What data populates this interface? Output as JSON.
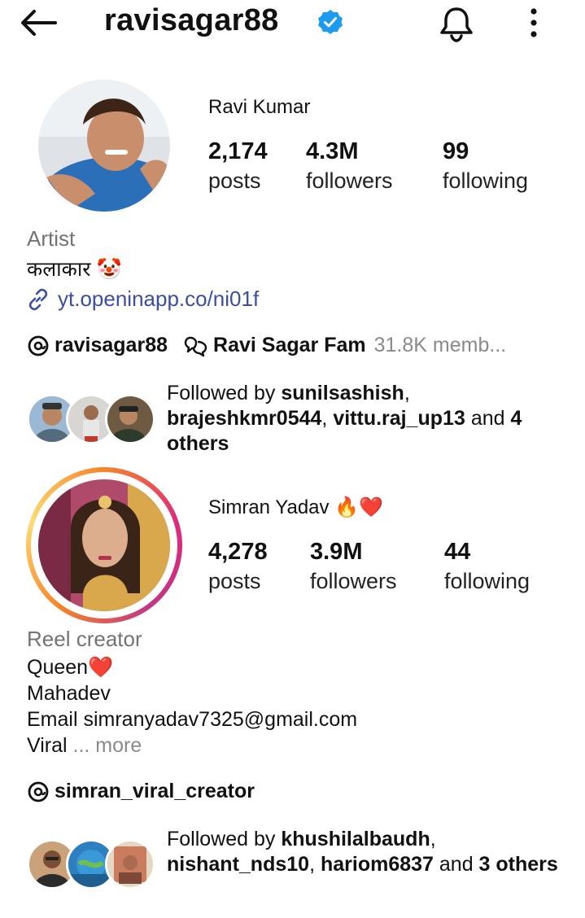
{
  "header": {
    "username": "ravisagar88",
    "back_icon": "arrow-left-icon",
    "verified_icon": "verified-badge-icon",
    "notifications_icon": "bell-icon",
    "menu_icon": "more-vertical-icon"
  },
  "profiles": [
    {
      "name": "Ravi Kumar",
      "stats": [
        {
          "value": "2,174",
          "label": "posts"
        },
        {
          "value": "4.3M",
          "label": "followers"
        },
        {
          "value": "99",
          "label": "following"
        }
      ],
      "category": "Artist",
      "bio": [
        "कलाकार 🤡"
      ],
      "link": "yt.openinapp.co/ni01f",
      "threads_handle": "ravisagar88",
      "community_name": "Ravi Sagar Fam",
      "community_members": "31.8K memb...",
      "followed_by_prefix": "Followed by ",
      "followed_by_users": [
        "sunilsashish",
        "brajeshkmr0544",
        "vittu.raj_up13"
      ],
      "followed_by_sep1": ",",
      "followed_by_sep2": ", ",
      "followed_by_and": " and ",
      "followed_by_others": "4 others"
    },
    {
      "name": "Simran Yadav 🔥❤️",
      "stats": [
        {
          "value": "4,278",
          "label": "posts"
        },
        {
          "value": "3.9M",
          "label": "followers"
        },
        {
          "value": "44",
          "label": "following"
        }
      ],
      "category": "Reel creator",
      "bio": [
        "Queen❤️",
        "Mahadev",
        "Email simranyadav7325@gmail.com",
        "Viral"
      ],
      "bio_more": "... more",
      "threads_handle": "simran_viral_creator",
      "followed_by_prefix": "Followed by ",
      "followed_by_users": [
        "khushilalbaudh",
        "nishant_nds10",
        "hariom6837"
      ],
      "followed_by_sep1": ",",
      "followed_by_sep2": ", ",
      "followed_by_and": " and ",
      "followed_by_others": "3 others"
    }
  ],
  "colors": {
    "link": "#3b4ea3",
    "verified": "#1d9bf0",
    "muted": "#737373",
    "story_ring_start": "#f58529",
    "story_ring_end": "#dd2a7b"
  }
}
